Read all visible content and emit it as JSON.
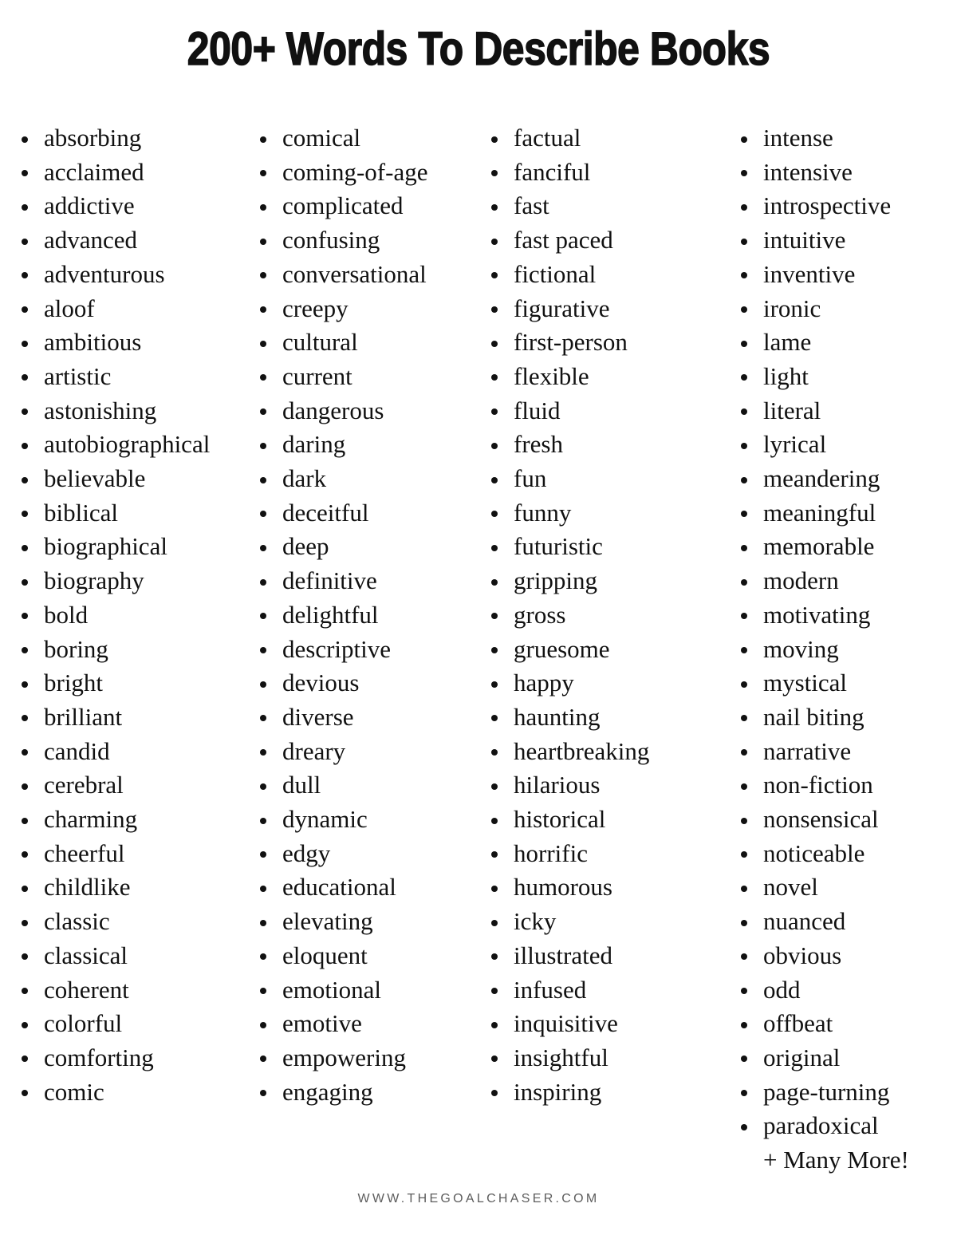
{
  "page": {
    "title": "200+ Words To Describe Books",
    "background_color": "#ffffff",
    "text_color": "#111111"
  },
  "columns": [
    {
      "id": "column-1",
      "items": [
        "absorbing",
        "acclaimed",
        "addictive",
        "advanced",
        "adventurous",
        "aloof",
        "ambitious",
        "artistic",
        "astonishing",
        "autobiographical",
        "believable",
        "biblical",
        "biographical",
        "biography",
        "bold",
        "boring",
        "bright",
        "brilliant",
        "candid",
        "cerebral",
        "charming",
        "cheerful",
        "childlike",
        "classic",
        "classical",
        "coherent",
        "colorful",
        "comforting",
        "comic"
      ]
    },
    {
      "id": "column-2",
      "items": [
        "comical",
        "coming-of-age",
        "complicated",
        "confusing",
        "conversational",
        "creepy",
        "cultural",
        "current",
        "dangerous",
        "daring",
        "dark",
        "deceitful",
        "deep",
        "definitive",
        "delightful",
        "descriptive",
        "devious",
        "diverse",
        "dreary",
        "dull",
        "dynamic",
        "edgy",
        "educational",
        "elevating",
        "eloquent",
        "emotional",
        "emotive",
        "empowering",
        "engaging"
      ]
    },
    {
      "id": "column-3",
      "items": [
        "factual",
        "fanciful",
        "fast",
        "fast paced",
        "fictional",
        "figurative",
        "first-person",
        "flexible",
        "fluid",
        "fresh",
        "fun",
        "funny",
        "futuristic",
        "gripping",
        "gross",
        "gruesome",
        "happy",
        "haunting",
        "heartbreaking",
        "hilarious",
        "historical",
        "horrific",
        "humorous",
        "icky",
        "illustrated",
        "infused",
        "inquisitive",
        "insightful",
        "inspiring"
      ]
    },
    {
      "id": "column-4",
      "items": [
        "intense",
        "intensive",
        "introspective",
        "intuitive",
        "inventive",
        "ironic",
        "lame",
        "light",
        "literal",
        "lyrical",
        "meandering",
        "meaningful",
        "memorable",
        "modern",
        "motivating",
        "moving",
        "mystical",
        "nail biting",
        "narrative",
        "non-fiction",
        "nonsensical",
        "noticeable",
        "novel",
        "nuanced",
        "obvious",
        "odd",
        "offbeat",
        "original",
        "page-turning",
        "paradoxical"
      ],
      "trailing_note": "+ Many More!"
    }
  ],
  "footer": {
    "url": "WWW.THEGOALCHASER.COM",
    "color": "#5d5d5d"
  }
}
